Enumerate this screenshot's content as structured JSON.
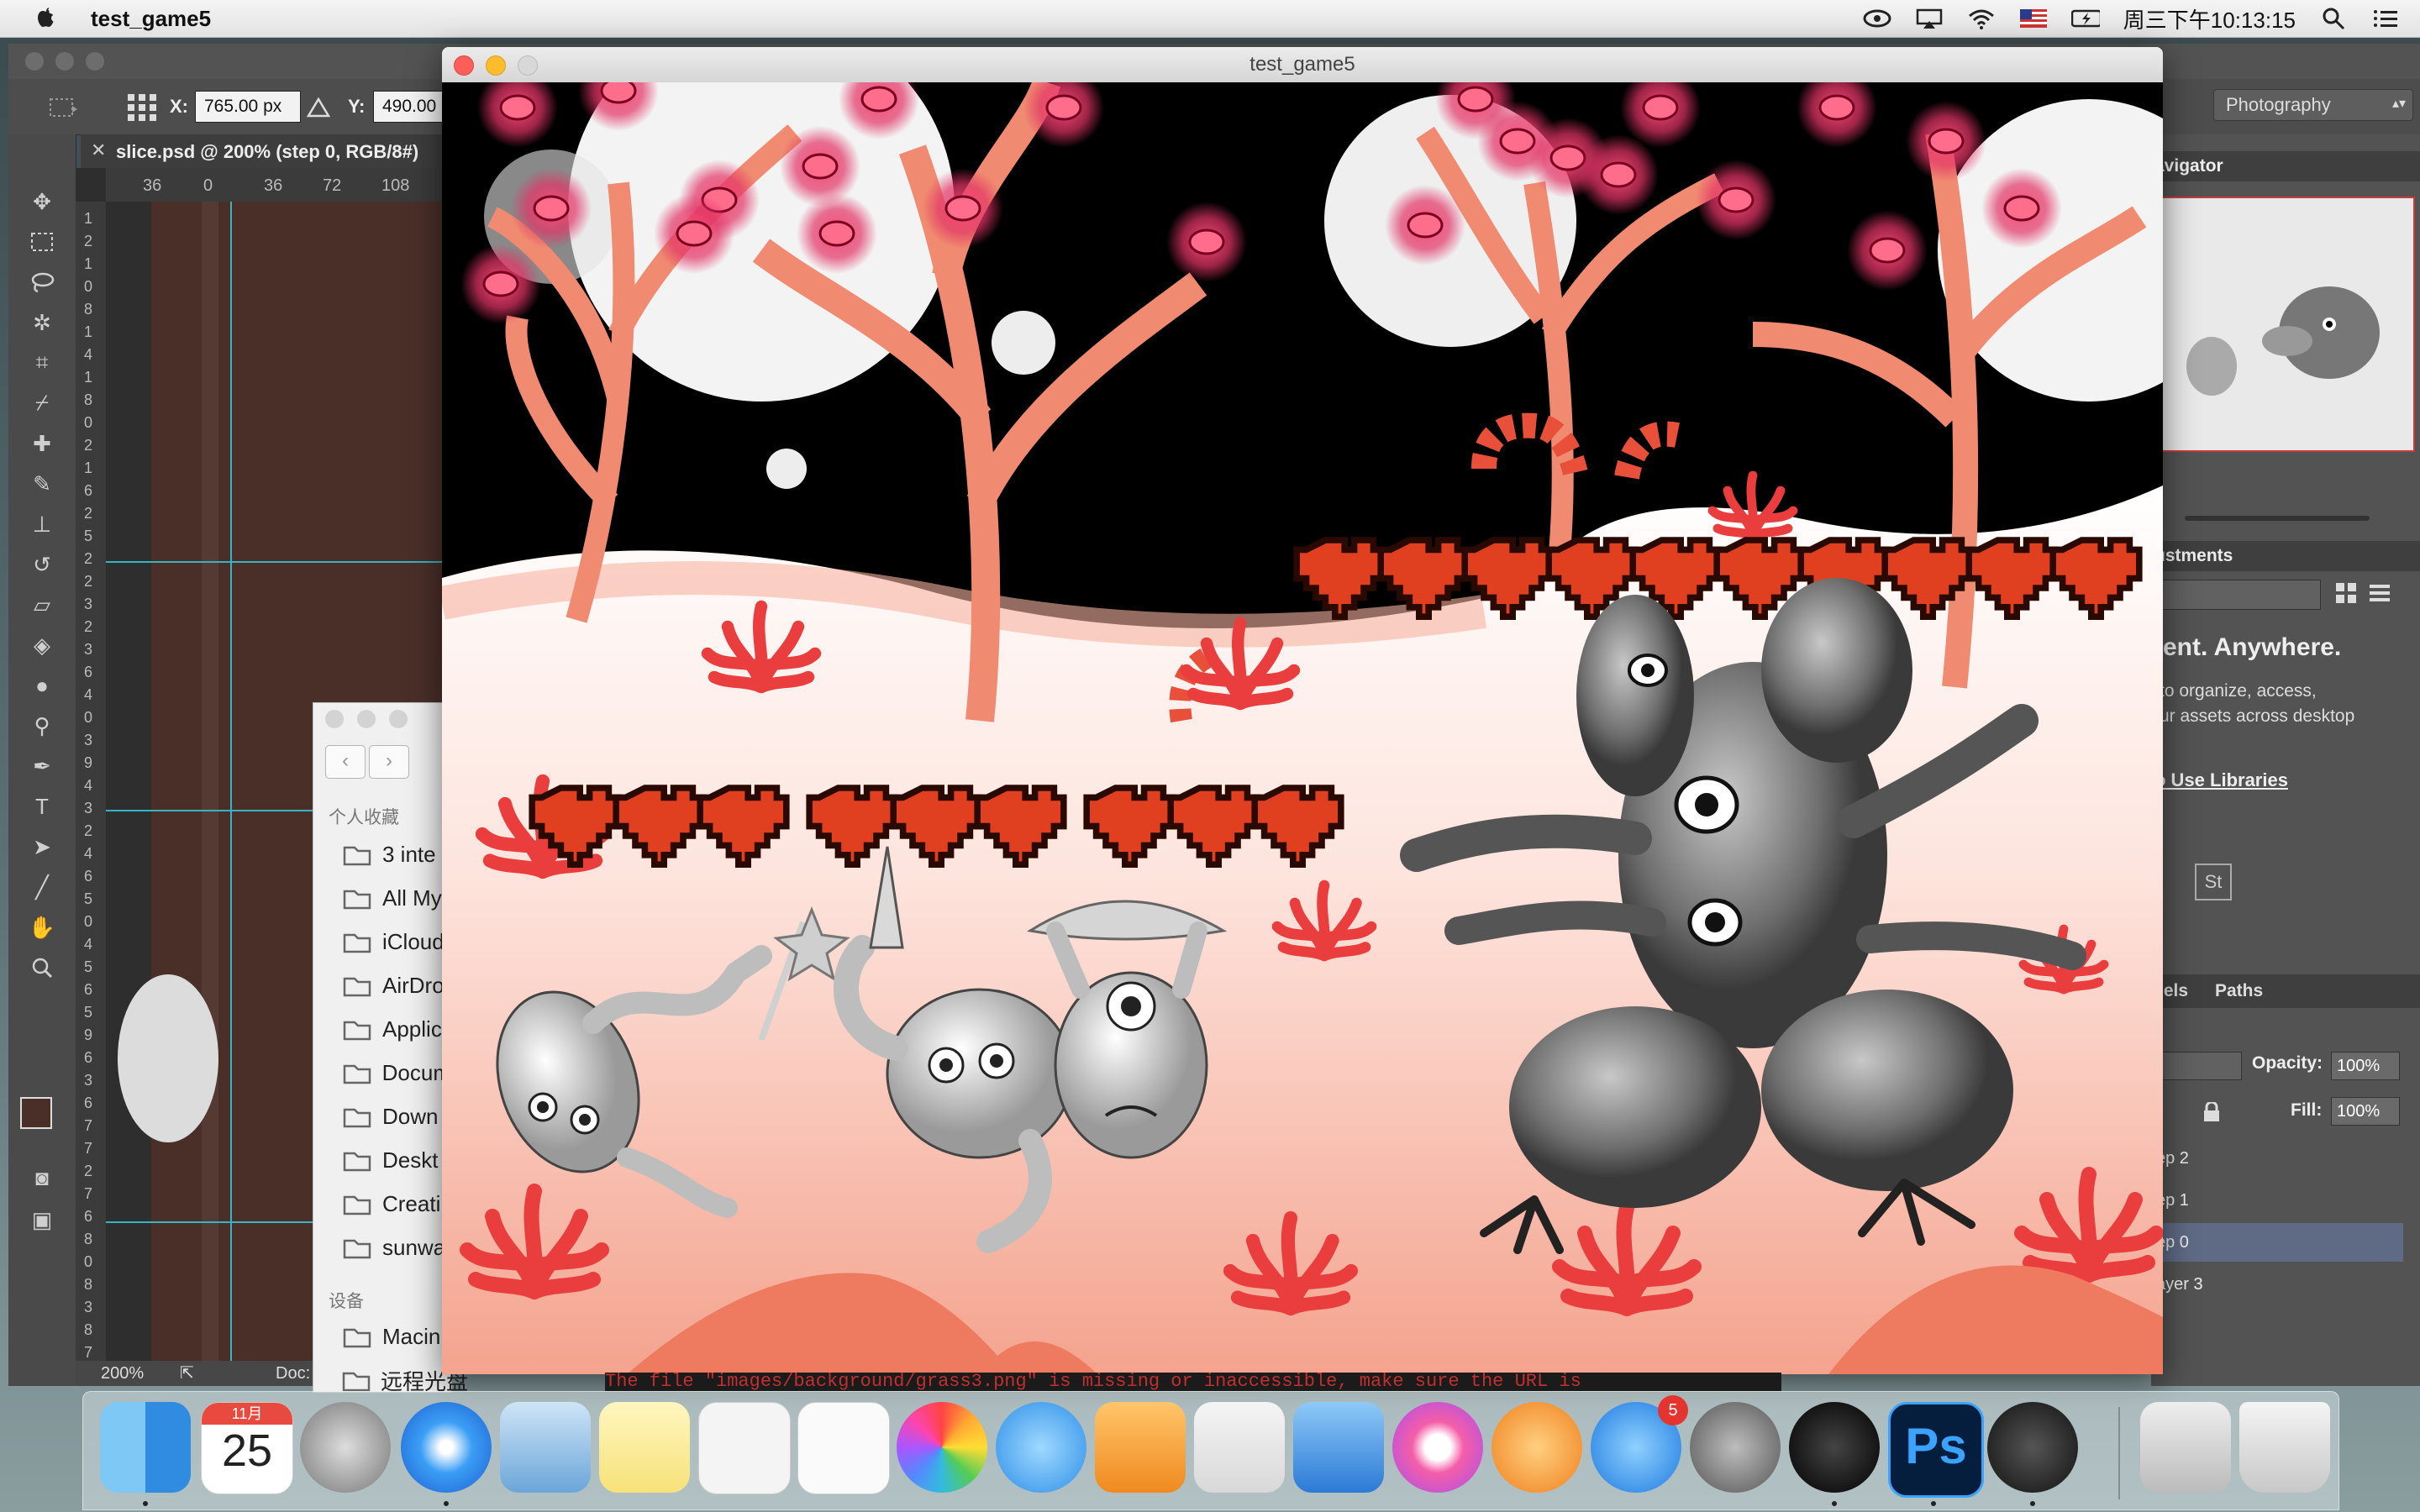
{
  "menubar": {
    "app_name": "test_game5",
    "clock": "周三下午10:13:15"
  },
  "photoshop": {
    "x_label": "X:",
    "x_value": "765.00 px",
    "y_label": "Y:",
    "y_value": "490.00 p",
    "workspace": "Photography",
    "doc_tab": "slice.psd @ 200% (step 0, RGB/8#)",
    "ruler_h": [
      "36",
      "0",
      "36",
      "72",
      "108"
    ],
    "ruler_v": [
      "1",
      "2",
      "1",
      "0",
      "8",
      "1",
      "4",
      "1",
      "8",
      "0",
      "2",
      "1",
      "6",
      "2",
      "5",
      "2",
      "2",
      "3",
      "2",
      "3",
      "6",
      "4",
      "0",
      "3",
      "9",
      "4",
      "3",
      "2",
      "4",
      "6",
      "5",
      "0",
      "4",
      "5",
      "6",
      "5",
      "9",
      "6",
      "3",
      "6",
      "7",
      "7",
      "2",
      "7",
      "6",
      "8",
      "0",
      "8",
      "3",
      "8",
      "7"
    ],
    "zoom": "200%",
    "doc_label": "Doc:",
    "navigator_title": "avigator",
    "adjustments_title": "ustments",
    "libraries_heading": "tent. Anywhere.",
    "libraries_text": "to organize, access,\nur assets across desktop",
    "libraries_link": "o Use Libraries",
    "st_label": "St",
    "panels_tabs": [
      "nels",
      "Paths"
    ],
    "opacity_label": "Opacity:",
    "opacity_value": "100%",
    "fill_label": "Fill:",
    "fill_value": "100%",
    "layers": [
      "ep 2",
      "ep 1",
      "ep 0",
      "ayer 3"
    ],
    "selected_layer_index": 2
  },
  "finder": {
    "favorites_header": "个人收藏",
    "favorites": [
      "3 inte",
      "All My",
      "iCloud",
      "AirDro",
      "Applic",
      "Docum",
      "Down",
      "Deskt",
      "Creati",
      "sunwa"
    ],
    "devices_header": "设备",
    "devices": [
      "Macin",
      "远程光盘"
    ]
  },
  "game": {
    "title": "test_game5",
    "hearts_top_count": 10,
    "hearts_left_groups": [
      3,
      3,
      3
    ],
    "error_text": "The file \"images/background/grass3.png\" is missing or inaccessible, make sure the URL is"
  },
  "dock": {
    "calendar_month": "11月",
    "calendar_day": "25",
    "appstore_badge": "5",
    "apps": [
      "finder-icon",
      "calendar-icon",
      "launchpad-icon",
      "safari-icon",
      "preview-icon",
      "notes-icon",
      "textedit-icon",
      "reminders-icon",
      "photos-icon",
      "messages-icon",
      "pages-icon",
      "numbers-icon",
      "keynote-icon",
      "itunes-icon",
      "ibooks-icon",
      "appstore-icon",
      "system-preferences-icon",
      "bbedit-icon",
      "photoshop-icon",
      "quicktime-icon",
      "screen-icon",
      "trash-icon"
    ]
  },
  "colors": {
    "heart": "#e04020",
    "heart_outline": "#2a0a00",
    "ps_dark": "#4a4a4a",
    "tree_salmon": "#f08a70",
    "eye_pink": "#e8507a"
  }
}
